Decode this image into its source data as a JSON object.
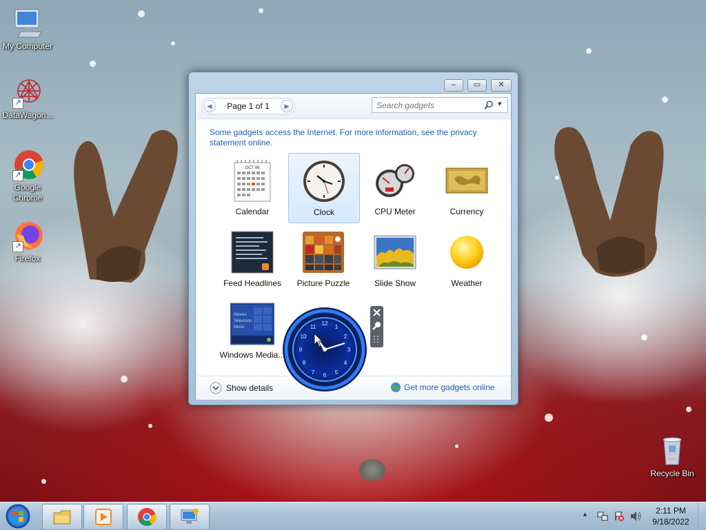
{
  "desktop": {
    "icons": [
      {
        "label": "My Computer",
        "icon": "computer-icon"
      },
      {
        "label": "DataWagon...",
        "icon": "datawagon-icon"
      },
      {
        "label": "Google Chrome",
        "line1": "Google",
        "line2": "Chrome",
        "icon": "chrome-icon"
      },
      {
        "label": "Firefox",
        "icon": "firefox-icon"
      },
      {
        "label": "Recycle Bin",
        "icon": "recycle-bin-icon"
      }
    ]
  },
  "window": {
    "caption_buttons": {
      "minimize": "–",
      "restore": "▭",
      "close": "✕"
    },
    "pager": {
      "text": "Page 1 of 1",
      "prev": "◀",
      "next": "▶"
    },
    "search": {
      "placeholder": "Search gadgets",
      "icon": "magnifier-icon",
      "dropdown": "▾"
    },
    "info": "Some gadgets access the Internet.  For more information, see the privacy statement online.",
    "gadgets": [
      {
        "label": "Calendar",
        "icon": "calendar-icon",
        "month": "OCT 06"
      },
      {
        "label": "Clock",
        "icon": "clock-icon",
        "selected": true
      },
      {
        "label": "CPU Meter",
        "icon": "cpu-meter-icon"
      },
      {
        "label": "Currency",
        "icon": "currency-icon"
      },
      {
        "label": "Feed Headlines",
        "icon": "feed-headlines-icon"
      },
      {
        "label": "Picture Puzzle",
        "icon": "picture-puzzle-icon"
      },
      {
        "label": "Slide Show",
        "icon": "slide-show-icon"
      },
      {
        "label": "Weather",
        "icon": "weather-icon"
      },
      {
        "label": "Windows Media...",
        "icon": "windows-media-center-icon",
        "menu": [
          "Movies",
          "Television",
          "Music"
        ]
      }
    ],
    "footer": {
      "show_details": "Show details",
      "get_more": "Get more gadgets online"
    }
  },
  "taskbar": {
    "start": "start-orb-icon",
    "pinned": [
      "file-explorer-icon",
      "media-player-icon",
      "chrome-icon",
      "control-panel-icon"
    ],
    "tray": {
      "time": "2:11 PM",
      "date": "9/18/2022",
      "show_hidden": "▲"
    }
  },
  "colors": {
    "link": "#1e5fb3",
    "selected_bg": "#d6eafc",
    "taskbar": "#a9c2d8"
  }
}
